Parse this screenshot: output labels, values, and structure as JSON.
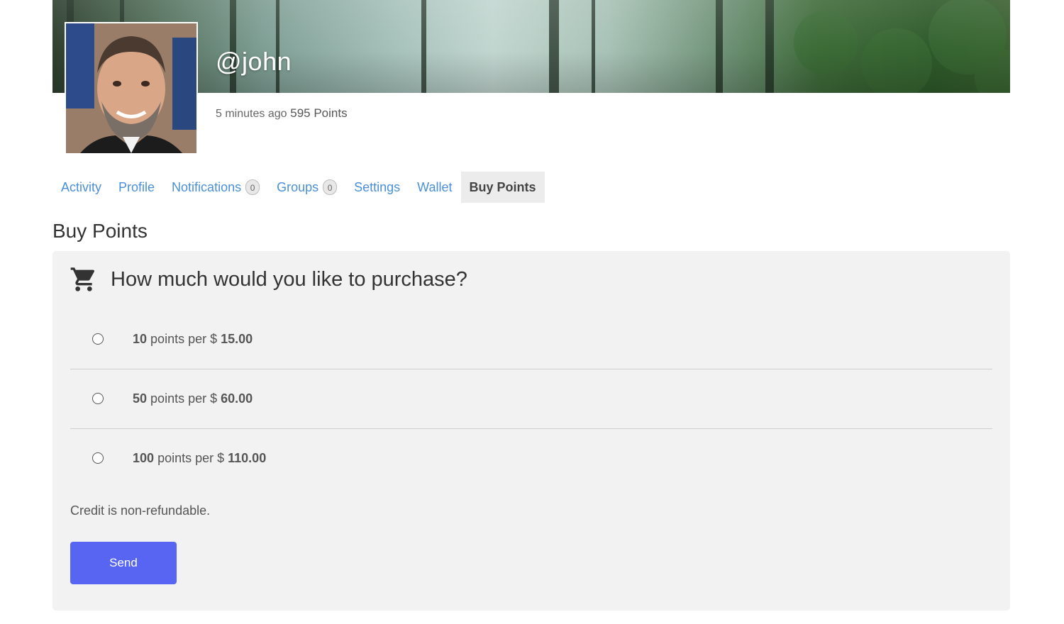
{
  "profile": {
    "username": "@john",
    "last_active": "5 minutes ago",
    "points": "595 Points"
  },
  "tabs": [
    {
      "label": "Activity"
    },
    {
      "label": "Profile"
    },
    {
      "label": "Notifications",
      "badge": "0"
    },
    {
      "label": "Groups",
      "badge": "0"
    },
    {
      "label": "Settings"
    },
    {
      "label": "Wallet"
    },
    {
      "label": "Buy Points",
      "active": true
    }
  ],
  "section_title": "Buy Points",
  "purchase": {
    "question": "How much would you like to purchase?",
    "options": [
      {
        "points": "10",
        "middle": "points per $",
        "price": "15.00"
      },
      {
        "points": "50",
        "middle": "points per $",
        "price": "60.00"
      },
      {
        "points": "100",
        "middle": "points per $",
        "price": "110.00"
      }
    ],
    "note": "Credit is non-refundable.",
    "send_label": "Send"
  },
  "colors": {
    "link": "#4a90d9",
    "button": "#5865f2",
    "panel": "#f2f2f2"
  },
  "icons": {
    "cart": "shopping-cart-icon"
  }
}
